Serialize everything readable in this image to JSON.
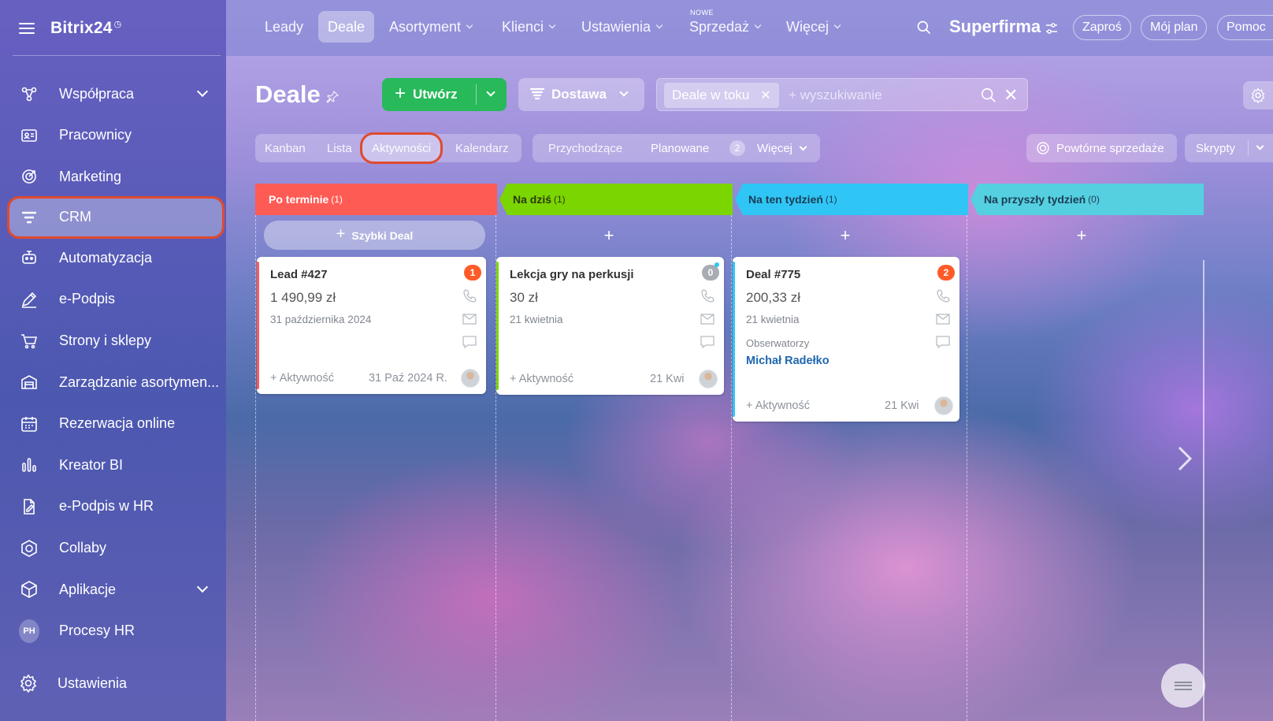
{
  "sidebar": {
    "logo": "Bitrix24",
    "items": [
      {
        "label": "Współpraca",
        "icon": "collaboration-icon",
        "chevron": true
      },
      {
        "label": "Pracownicy",
        "icon": "employees-icon"
      },
      {
        "label": "Marketing",
        "icon": "marketing-icon"
      },
      {
        "label": "CRM",
        "icon": "crm-icon",
        "active": true
      },
      {
        "label": "Automatyzacja",
        "icon": "automation-icon"
      },
      {
        "label": "e-Podpis",
        "icon": "e-signature-icon"
      },
      {
        "label": "Strony i sklepy",
        "icon": "cart-icon"
      },
      {
        "label": "Zarządzanie asortymen...",
        "icon": "inventory-icon"
      },
      {
        "label": "Rezerwacja online",
        "icon": "calendar-icon"
      },
      {
        "label": "Kreator BI",
        "icon": "bar-chart-icon"
      },
      {
        "label": "e-Podpis w HR",
        "icon": "hr-signature-icon"
      },
      {
        "label": "Collaby",
        "icon": "collaby-icon"
      },
      {
        "label": "Aplikacje",
        "icon": "apps-icon",
        "chevron": true
      },
      {
        "label": "Procesy HR",
        "badge": "PH"
      }
    ],
    "settings": "Ustawienia"
  },
  "topnav": {
    "items": [
      "Leady",
      "Deale",
      "Asortyment",
      "Klienci",
      "Ustawienia",
      "Sprzedaż",
      "Więcej"
    ],
    "nowe": "NOWE",
    "brand": "Superfirma",
    "invite": "Zaproś",
    "plan": "Mój plan",
    "help": "Pomoc"
  },
  "toolbar": {
    "title": "Deale",
    "create": "Utwórz",
    "pipeline": "Dostawa",
    "filter_chip": "Deale w toku",
    "search_placeholder": "+ wyszukiwanie"
  },
  "views": {
    "tabs": [
      "Kanban",
      "Lista",
      "Aktywności",
      "Kalendarz"
    ],
    "activity": [
      "Przychodzące",
      "Planowane",
      "Więcej"
    ],
    "planned_count": "2",
    "repeat_sales": "Powtórne sprzedaże",
    "scripts": "Skrypty"
  },
  "columns": [
    {
      "title": "Po terminie",
      "count": "(1)",
      "color": "#ff5b55"
    },
    {
      "title": "Na dziś",
      "count": "(1)",
      "color": "#7bd500"
    },
    {
      "title": "Na ten tydzień",
      "count": "(1)",
      "color": "#2fc6f6"
    },
    {
      "title": "Na przyszły tydzień",
      "count": "(0)",
      "color": "#55d0e0"
    }
  ],
  "quick_deal": "Szybki Deal",
  "cards": [
    {
      "title": "Lead #427",
      "price": "1 490,99 zł",
      "date": "31 października 2024",
      "badge": "1",
      "activity": "+ Aktywność",
      "footer_date": "31 Paź 2024 R."
    },
    {
      "title": "Lekcja gry na perkusji",
      "price": "30 zł",
      "date": "21 kwietnia",
      "badge": "0",
      "activity": "+ Aktywność",
      "footer_date": "21 Kwi"
    },
    {
      "title": "Deal #775",
      "price": "200,33 zł",
      "date": "21 kwietnia",
      "badge": "2",
      "observers_label": "Obserwatorzy",
      "observer": "Michał Radełko",
      "activity": "+ Aktywność",
      "footer_date": "21 Kwi"
    }
  ]
}
